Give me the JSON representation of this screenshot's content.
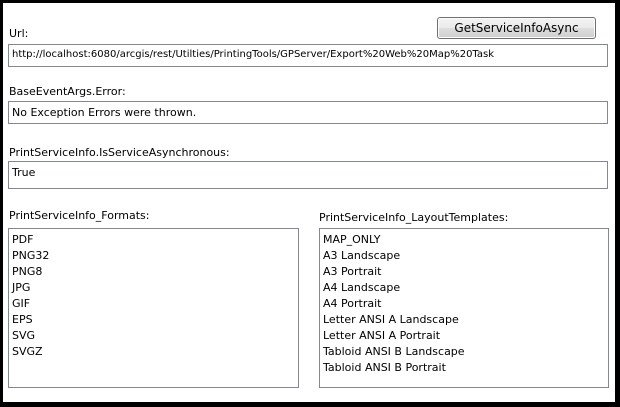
{
  "url_label": "Url:",
  "url_value": "http://localhost:6080/arcgis/rest/Utilties/PrintingTools/GPServer/Export%20Web%20Map%20Task",
  "get_button_label": "GetServiceInfoAsync",
  "error_label": "BaseEventArgs.Error:",
  "error_value": "No Exception Errors were thrown.",
  "async_label": "PrintServiceInfo.IsServiceAsynchronous:",
  "async_value": "True",
  "formats_label": "PrintServiceInfo_Formats:",
  "formats": [
    "PDF",
    "PNG32",
    "PNG8",
    "JPG",
    "GIF",
    "EPS",
    "SVG",
    "SVGZ"
  ],
  "layouts_label": "PrintServiceInfo_LayoutTemplates:",
  "layouts": [
    "MAP_ONLY",
    "A3 Landscape",
    "A3 Portrait",
    "A4 Landscape",
    "A4 Portrait",
    "Letter ANSI A Landscape",
    "Letter ANSI A Portrait",
    "Tabloid ANSI B Landscape",
    "Tabloid ANSI B Portrait"
  ]
}
